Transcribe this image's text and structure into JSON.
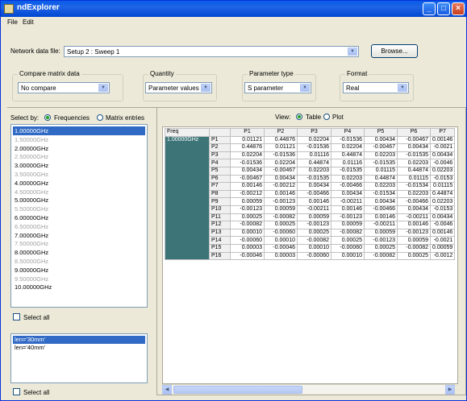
{
  "window": {
    "title": "ndExplorer"
  },
  "menu": {
    "file": "File",
    "edit": "Edit"
  },
  "network": {
    "label": "Network data file:",
    "value": "Setup 2 : Sweep 1",
    "browse": "Browse..."
  },
  "compare": {
    "title": "Compare matrix data",
    "value": "No compare"
  },
  "quantity": {
    "title": "Quantity",
    "value": "Parameter values"
  },
  "param_type": {
    "title": "Parameter type",
    "value": "S parameter"
  },
  "format": {
    "title": "Format",
    "value": "Real"
  },
  "select_by": {
    "label": "Select by:",
    "frequencies": "Frequencies",
    "matrix_entries": "Matrix entries"
  },
  "frequencies": [
    {
      "label": "1.00000GHz",
      "state": "selected"
    },
    {
      "label": "1.50000GHz",
      "state": "dim"
    },
    {
      "label": "2.00000GHz",
      "state": "normal"
    },
    {
      "label": "2.50000GHz",
      "state": "dim"
    },
    {
      "label": "3.00000GHz",
      "state": "normal"
    },
    {
      "label": "3.50000GHz",
      "state": "dim"
    },
    {
      "label": "4.00000GHz",
      "state": "normal"
    },
    {
      "label": "4.50000GHz",
      "state": "dim"
    },
    {
      "label": "5.00000GHz",
      "state": "normal"
    },
    {
      "label": "5.50000GHz",
      "state": "dim"
    },
    {
      "label": "6.00000GHz",
      "state": "normal"
    },
    {
      "label": "6.50000GHz",
      "state": "dim"
    },
    {
      "label": "7.00000GHz",
      "state": "normal"
    },
    {
      "label": "7.50000GHz",
      "state": "dim"
    },
    {
      "label": "8.00000GHz",
      "state": "normal"
    },
    {
      "label": "8.50000GHz",
      "state": "dim"
    },
    {
      "label": "9.00000GHz",
      "state": "normal"
    },
    {
      "label": "9.50000GHz",
      "state": "dim"
    },
    {
      "label": "10.00000GHz",
      "state": "normal"
    }
  ],
  "select_all_1": "Select all",
  "lengths": [
    {
      "label": "len='30mm'",
      "state": "selected"
    },
    {
      "label": "len='40mm'",
      "state": "normal"
    }
  ],
  "select_all_2": "Select all",
  "view": {
    "label": "View:",
    "table": "Table",
    "plot": "Plot"
  },
  "table": {
    "freq_header": "Freq",
    "freq_value": "1.00000GHz",
    "columns": [
      "P1",
      "P2",
      "P3",
      "P4",
      "P5",
      "P6",
      "P7"
    ],
    "rows": [
      {
        "name": "P1",
        "values": [
          "0.01121",
          "0.44876",
          "0.02204",
          "-0.01536",
          "0.00434",
          "-0.00467",
          "0.00146"
        ]
      },
      {
        "name": "P2",
        "values": [
          "0.44876",
          "0.01121",
          "-0.01536",
          "0.02204",
          "-0.00467",
          "0.00434",
          "-0.0021"
        ]
      },
      {
        "name": "P3",
        "values": [
          "0.02204",
          "-0.01536",
          "0.01116",
          "0.44874",
          "0.02203",
          "-0.01535",
          "0.00434"
        ]
      },
      {
        "name": "P4",
        "values": [
          "-0.01536",
          "0.02204",
          "0.44874",
          "0.01116",
          "-0.01535",
          "0.02203",
          "-0.0046"
        ]
      },
      {
        "name": "P5",
        "values": [
          "0.00434",
          "-0.00467",
          "0.02203",
          "-0.01535",
          "0.01115",
          "0.44874",
          "0.02203"
        ]
      },
      {
        "name": "P6",
        "values": [
          "-0.00467",
          "0.00434",
          "-0.01535",
          "0.02203",
          "0.44874",
          "0.01115",
          "-0.0153"
        ]
      },
      {
        "name": "P7",
        "values": [
          "0.00146",
          "-0.00212",
          "0.00434",
          "-0.00466",
          "0.02203",
          "-0.01534",
          "0.01115"
        ]
      },
      {
        "name": "P8",
        "values": [
          "-0.00212",
          "0.00146",
          "-0.00466",
          "0.00434",
          "-0.01534",
          "0.02203",
          "0.44874"
        ]
      },
      {
        "name": "P9",
        "values": [
          "0.00059",
          "-0.00123",
          "0.00146",
          "-0.00211",
          "0.00434",
          "-0.00466",
          "0.02203"
        ]
      },
      {
        "name": "P10",
        "values": [
          "-0.00123",
          "0.00059",
          "-0.00211",
          "0.00146",
          "-0.00466",
          "0.00434",
          "-0.0153"
        ]
      },
      {
        "name": "P11",
        "values": [
          "0.00025",
          "-0.00082",
          "0.00059",
          "-0.00123",
          "0.00146",
          "-0.00211",
          "0.00434"
        ]
      },
      {
        "name": "P12",
        "values": [
          "-0.00082",
          "0.00025",
          "-0.00123",
          "0.00059",
          "-0.00211",
          "0.00146",
          "-0.0046"
        ]
      },
      {
        "name": "P13",
        "values": [
          "0.00010",
          "-0.00060",
          "0.00025",
          "-0.00082",
          "0.00059",
          "-0.00123",
          "0.00146"
        ]
      },
      {
        "name": "P14",
        "values": [
          "-0.00060",
          "0.00010",
          "-0.00082",
          "0.00025",
          "-0.00123",
          "0.00059",
          "-0.0021"
        ]
      },
      {
        "name": "P15",
        "values": [
          "0.00003",
          "-0.00046",
          "0.00010",
          "-0.00060",
          "0.00025",
          "-0.00082",
          "0.00059"
        ]
      },
      {
        "name": "P16",
        "values": [
          "-0.00046",
          "0.00003",
          "-0.00060",
          "0.00010",
          "-0.00082",
          "0.00025",
          "-0.0012"
        ]
      }
    ]
  },
  "colors": {
    "title_bar": "#0a5ce8",
    "selection": "#316ac5",
    "freq_cell": "#3c7478"
  }
}
